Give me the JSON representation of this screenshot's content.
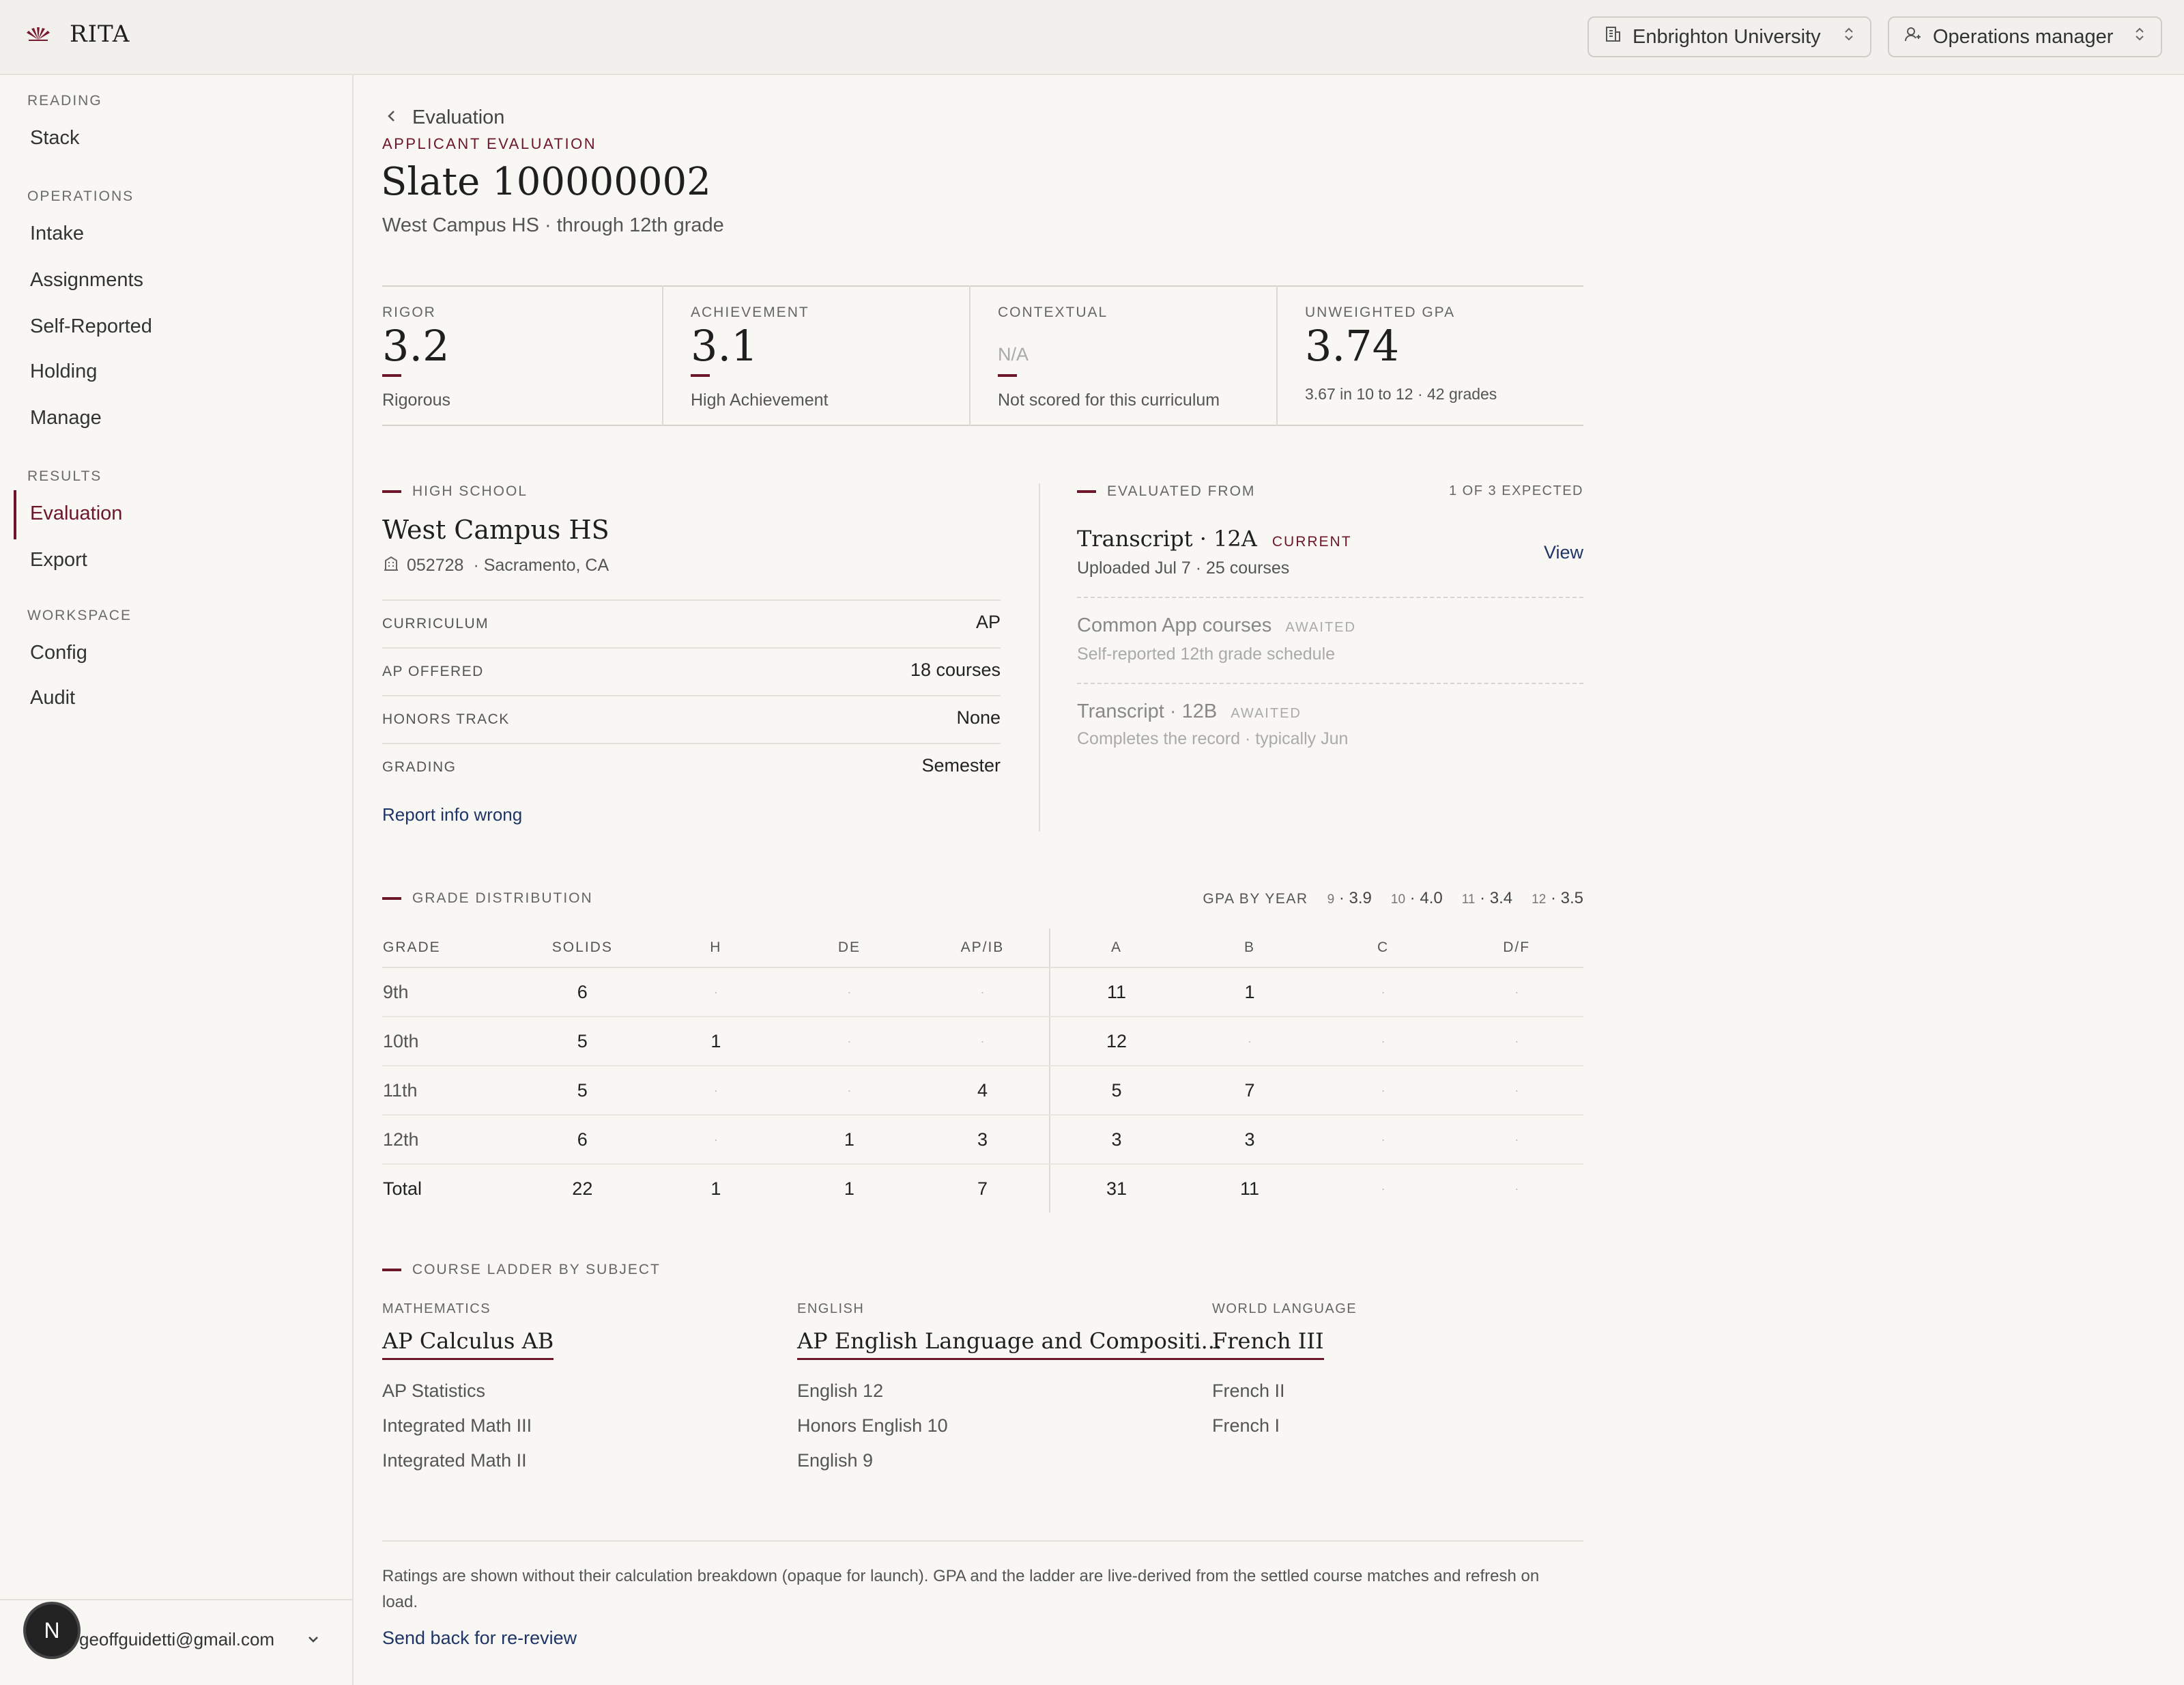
{
  "app": {
    "name": "RITA"
  },
  "header": {
    "institution": "Enbrighton University",
    "role": "Operations manager"
  },
  "sidebar": {
    "sections": [
      {
        "label": "READING",
        "items": [
          {
            "label": "Stack"
          }
        ]
      },
      {
        "label": "OPERATIONS",
        "items": [
          {
            "label": "Intake"
          },
          {
            "label": "Assignments"
          },
          {
            "label": "Self-Reported"
          },
          {
            "label": "Holding"
          },
          {
            "label": "Manage"
          }
        ]
      },
      {
        "label": "RESULTS",
        "items": [
          {
            "label": "Evaluation",
            "active": true
          },
          {
            "label": "Export"
          }
        ]
      },
      {
        "label": "WORKSPACE",
        "items": [
          {
            "label": "Config"
          },
          {
            "label": "Audit"
          }
        ]
      }
    ],
    "user": {
      "initial": "N",
      "email": "geoffguidetti@gmail.com"
    }
  },
  "page": {
    "breadcrumb": "Evaluation",
    "eyebrow": "APPLICANT EVALUATION",
    "title": "Slate 100000002",
    "subtitle": "West Campus HS · through 12th grade"
  },
  "metrics": [
    {
      "label": "RIGOR",
      "value": "3.2",
      "caption": "Rigorous"
    },
    {
      "label": "ACHIEVEMENT",
      "value": "3.1",
      "caption": "High Achievement"
    },
    {
      "label": "CONTEXTUAL",
      "value": "N/A",
      "caption": "Not scored for this curriculum"
    },
    {
      "label": "UNWEIGHTED GPA",
      "value": "3.74",
      "caption": "3.67 in 10 to 12 · 42 grades"
    }
  ],
  "high_school": {
    "section_label": "HIGH SCHOOL",
    "name": "West Campus HS",
    "code": "052728",
    "location": "· Sacramento, CA",
    "rows": [
      {
        "key": "CURRICULUM",
        "value": "AP"
      },
      {
        "key": "AP OFFERED",
        "value": "18 courses"
      },
      {
        "key": "HONORS TRACK",
        "value": "None"
      },
      {
        "key": "GRADING",
        "value": "Semester"
      }
    ],
    "report_link": "Report info wrong"
  },
  "evaluated_from": {
    "section_label": "EVALUATED FROM",
    "count": "1 OF 3 EXPECTED",
    "sources": [
      {
        "title": "Transcript · 12A",
        "status": "CURRENT",
        "detail": "Uploaded Jul 7 · 25 courses",
        "action": "View"
      },
      {
        "title": "Common App courses",
        "status": "AWAITED",
        "detail": "Self-reported 12th grade schedule"
      },
      {
        "title": "Transcript · 12B",
        "status": "AWAITED",
        "detail": "Completes the record · typically Jun"
      }
    ]
  },
  "grade_distribution": {
    "section_label": "GRADE DISTRIBUTION",
    "gpa_by_year_label": "GPA BY YEAR",
    "gpa_by_year": [
      {
        "year": "9",
        "gpa": "3.9"
      },
      {
        "year": "10",
        "gpa": "4.0"
      },
      {
        "year": "11",
        "gpa": "3.4"
      },
      {
        "year": "12",
        "gpa": "3.5"
      }
    ],
    "columns": [
      "GRADE",
      "SOLIDS",
      "H",
      "DE",
      "AP/IB",
      "A",
      "B",
      "C",
      "D/F"
    ],
    "rows": [
      [
        "9th",
        "6",
        "·",
        "·",
        "·",
        "11",
        "1",
        "·",
        "·"
      ],
      [
        "10th",
        "5",
        "1",
        "·",
        "·",
        "12",
        "·",
        "·",
        "·"
      ],
      [
        "11th",
        "5",
        "·",
        "·",
        "4",
        "5",
        "7",
        "·",
        "·"
      ],
      [
        "12th",
        "6",
        "·",
        "1",
        "3",
        "3",
        "3",
        "·",
        "·"
      ]
    ],
    "total": [
      "Total",
      "22",
      "1",
      "1",
      "7",
      "31",
      "11",
      "·",
      "·"
    ]
  },
  "course_ladder": {
    "section_label": "COURSE LADDER BY SUBJECT",
    "subjects": [
      {
        "name": "MATHEMATICS",
        "top": "AP Calculus AB",
        "items": [
          "AP Statistics",
          "Integrated Math III",
          "Integrated Math II"
        ]
      },
      {
        "name": "ENGLISH",
        "top": "AP English Language and Compositi...",
        "items": [
          "English 12",
          "Honors English 10",
          "English 9"
        ]
      },
      {
        "name": "WORLD LANGUAGE",
        "top": "French III",
        "items": [
          "French II",
          "French I"
        ]
      }
    ]
  },
  "footer": {
    "note": "Ratings are shown without their calculation breakdown (opaque for launch). GPA and the ladder are live-derived from the settled course matches and refresh on load.",
    "action": "Send back for re-review"
  },
  "icons": {
    "logo": "rita-logo-icon",
    "institution": "building-icon",
    "role": "user-icon",
    "chevron": "chevron-up-down-icon"
  },
  "colors": {
    "accent": "#6e1629",
    "link": "#1f3567",
    "background": "#f8f7f3"
  }
}
